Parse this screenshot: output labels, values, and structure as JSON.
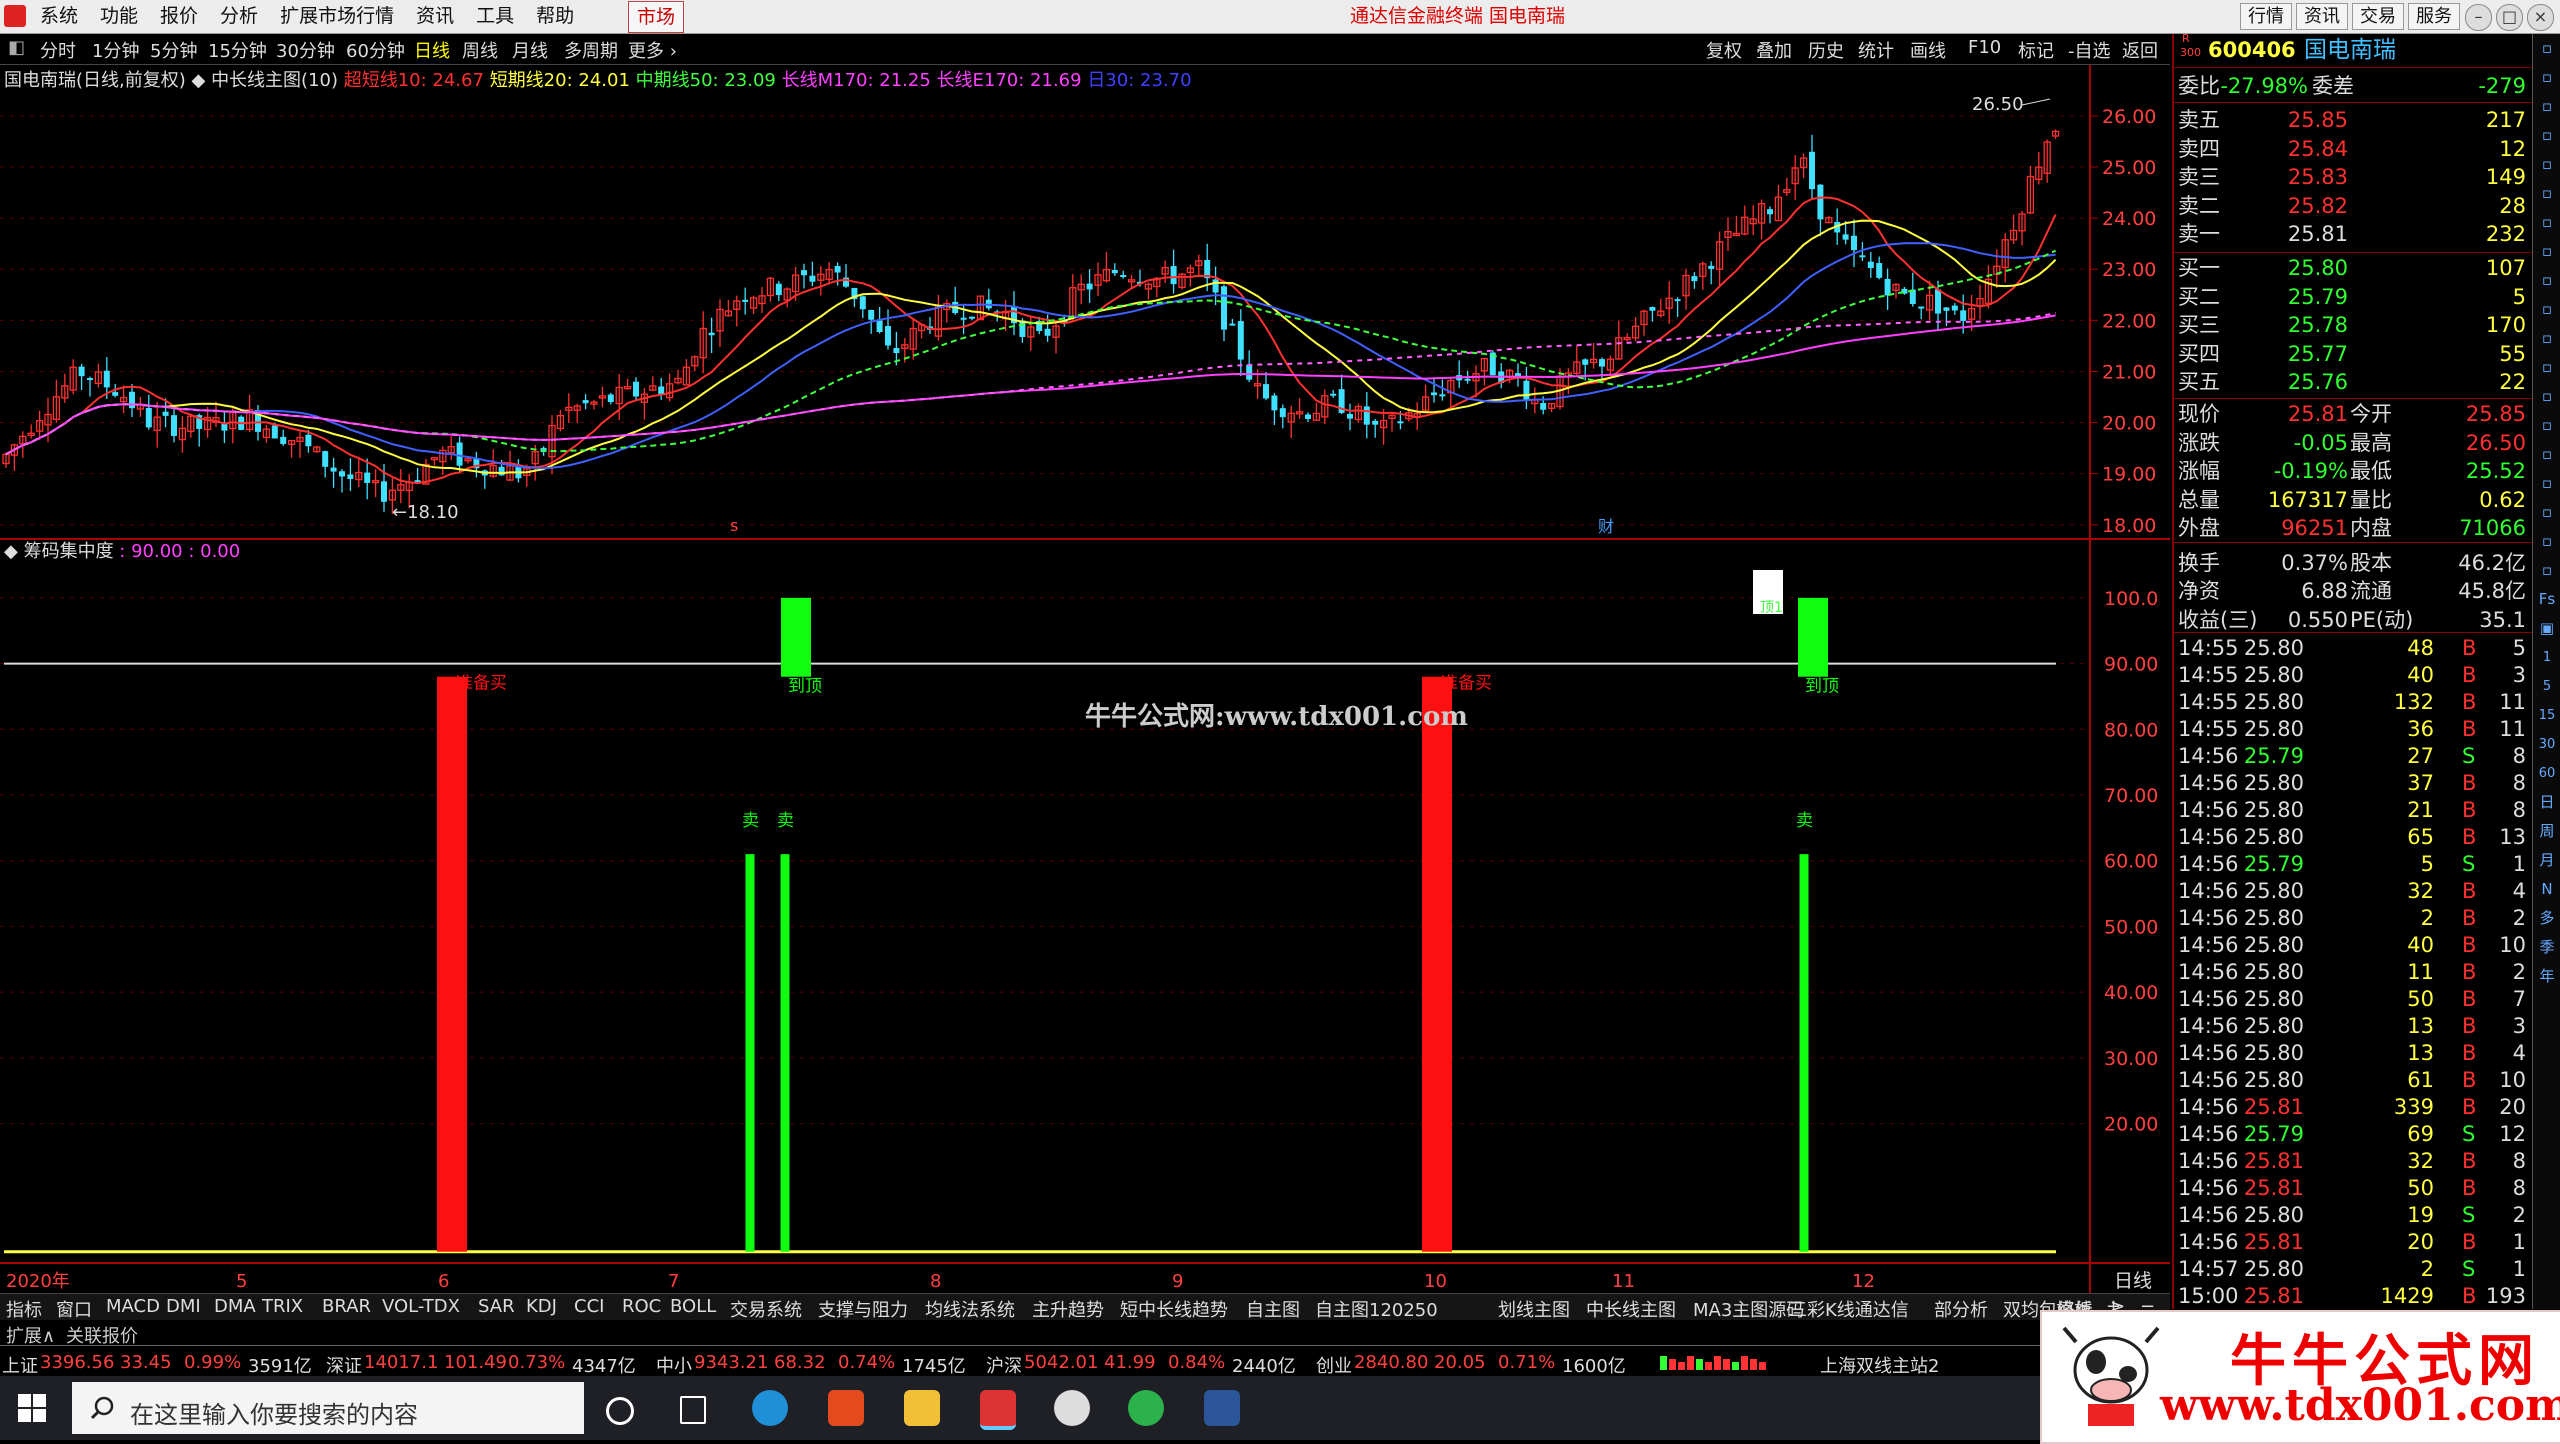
{
  "menu": [
    "系统",
    "功能",
    "报价",
    "分析",
    "扩展市场行情",
    "资讯",
    "工具",
    "帮助"
  ],
  "market_tab": "市场",
  "app_title": "通达信金融终端  国电南瑞",
  "top_buttons": [
    "行情",
    "资讯",
    "交易",
    "服务"
  ],
  "periods": [
    "分时",
    "1分钟",
    "5分钟",
    "15分钟",
    "30分钟",
    "60分钟",
    "日线",
    "周线",
    "月线",
    "多周期",
    "更多"
  ],
  "selected_period": "日线",
  "toolbar_right": [
    "复权",
    "叠加",
    "历史",
    "统计",
    "画线",
    "F10",
    "标记",
    "-自选",
    "返回"
  ],
  "chart_header": {
    "name": "国电南瑞(日线,前复权)",
    "indicator": "中长线主图(10)",
    "items": [
      {
        "text": "超短线10: 24.67",
        "color": "#ff3030"
      },
      {
        "text": "短期线20: 24.01",
        "color": "#ffff40"
      },
      {
        "text": "中期线50: 23.09",
        "color": "#40ff40"
      },
      {
        "text": "长线M170: 21.25",
        "color": "#ff40ff"
      },
      {
        "text": "长线E170: 21.69",
        "color": "#ff40ff"
      },
      {
        "text": "日30: 23.70",
        "color": "#4040ff"
      }
    ]
  },
  "sub_header": {
    "name": "筹码集中度",
    "values": ": 90.00 : 0.00"
  },
  "watermark": "牛牛公式网:www.tdx001.com",
  "chart_data": {
    "type": "candlestick",
    "price_ticks": [
      "26.00",
      "25.00",
      "24.00",
      "23.00",
      "22.00",
      "21.00",
      "20.00",
      "19.00",
      "18.00"
    ],
    "price_range": [
      17.8,
      26.8
    ],
    "high_label": "26.50",
    "low_label": "18.10",
    "osc_ticks": [
      "100.0",
      "90.00",
      "80.00",
      "70.00",
      "60.00",
      "50.00",
      "40.00",
      "30.00",
      "20.00"
    ],
    "osc_range": [
      0,
      105
    ],
    "osc_line": 90,
    "x_labels": [
      "2020年",
      "5",
      "6",
      "7",
      "8",
      "9",
      "10",
      "11",
      "12"
    ],
    "osc_signals": [
      {
        "label": "准备买",
        "value": 88,
        "color": "#ff1010",
        "kind": "buy"
      },
      {
        "label": "到顶",
        "value": 100,
        "color": "#10ff10",
        "kind": "top"
      },
      {
        "label": "卖",
        "value": 61,
        "color": "#10ff10",
        "kind": "sell"
      },
      {
        "label": "卖",
        "value": 61,
        "color": "#10ff10",
        "kind": "sell"
      },
      {
        "label": "准备买",
        "value": 88,
        "color": "#ff1010",
        "kind": "buy"
      },
      {
        "label": "到顶",
        "value": 100,
        "color": "#10ff10",
        "kind": "top"
      },
      {
        "label": "卖",
        "value": 61,
        "color": "#10ff10",
        "kind": "sell"
      }
    ],
    "bottom_right_label": "日线",
    "mark_cai": "财",
    "mark_s": "s"
  },
  "quote": {
    "code": "600406",
    "name": "国电南瑞",
    "weibi": {
      "label": "委比",
      "value": "-27.98%",
      "label2": "委差",
      "value2": "-279"
    },
    "sells": [
      {
        "label": "卖五",
        "price": "25.85",
        "vol": "217"
      },
      {
        "label": "卖四",
        "price": "25.84",
        "vol": "12"
      },
      {
        "label": "卖三",
        "price": "25.83",
        "vol": "149"
      },
      {
        "label": "卖二",
        "price": "25.82",
        "vol": "28"
      },
      {
        "label": "卖一",
        "price": "25.81",
        "vol": "232"
      }
    ],
    "buys": [
      {
        "label": "买一",
        "price": "25.80",
        "vol": "107"
      },
      {
        "label": "买二",
        "price": "25.79",
        "vol": "5"
      },
      {
        "label": "买三",
        "price": "25.78",
        "vol": "170"
      },
      {
        "label": "买四",
        "price": "25.77",
        "vol": "55"
      },
      {
        "label": "买五",
        "price": "25.76",
        "vol": "22"
      }
    ],
    "stats": [
      {
        "l1": "现价",
        "v1": "25.81",
        "c1": "#ff3030",
        "l2": "今开",
        "v2": "25.85",
        "c2": "#ff3030"
      },
      {
        "l1": "涨跌",
        "v1": "-0.05",
        "c1": "#30ff30",
        "l2": "最高",
        "v2": "26.50",
        "c2": "#ff3030"
      },
      {
        "l1": "涨幅",
        "v1": "-0.19%",
        "c1": "#30ff30",
        "l2": "最低",
        "v2": "25.52",
        "c2": "#30ff30"
      },
      {
        "l1": "总量",
        "v1": "167317",
        "c1": "#ffff40",
        "l2": "量比",
        "v2": "0.62",
        "c2": "#ffff40"
      },
      {
        "l1": "外盘",
        "v1": "96251",
        "c1": "#ff3030",
        "l2": "内盘",
        "v2": "71066",
        "c2": "#30ff30"
      },
      {
        "l1": "换手",
        "v1": "0.37%",
        "c1": "#dddddd",
        "l2": "股本",
        "v2": "46.2亿",
        "c2": "#dddddd"
      },
      {
        "l1": "净资",
        "v1": "6.88",
        "c1": "#dddddd",
        "l2": "流通",
        "v2": "45.8亿",
        "c2": "#dddddd"
      },
      {
        "l1": "收益(三)",
        "v1": "0.550",
        "c1": "#dddddd",
        "l2": "PE(动)",
        "v2": "35.1",
        "c2": "#dddddd"
      }
    ],
    "ticks": [
      [
        "14:55",
        "25.80",
        "48",
        "B",
        "5"
      ],
      [
        "14:55",
        "25.80",
        "40",
        "B",
        "3"
      ],
      [
        "14:55",
        "25.80",
        "132",
        "B",
        "11"
      ],
      [
        "14:55",
        "25.80",
        "36",
        "B",
        "11"
      ],
      [
        "14:56",
        "25.79",
        "27",
        "S",
        "8"
      ],
      [
        "14:56",
        "25.80",
        "37",
        "B",
        "8"
      ],
      [
        "14:56",
        "25.80",
        "21",
        "B",
        "8"
      ],
      [
        "14:56",
        "25.80",
        "65",
        "B",
        "13"
      ],
      [
        "14:56",
        "25.79",
        "5",
        "S",
        "1"
      ],
      [
        "14:56",
        "25.80",
        "32",
        "B",
        "4"
      ],
      [
        "14:56",
        "25.80",
        "2",
        "B",
        "2"
      ],
      [
        "14:56",
        "25.80",
        "40",
        "B",
        "10"
      ],
      [
        "14:56",
        "25.80",
        "11",
        "B",
        "2"
      ],
      [
        "14:56",
        "25.80",
        "50",
        "B",
        "7"
      ],
      [
        "14:56",
        "25.80",
        "13",
        "B",
        "3"
      ],
      [
        "14:56",
        "25.80",
        "13",
        "B",
        "4"
      ],
      [
        "14:56",
        "25.80",
        "61",
        "B",
        "10"
      ],
      [
        "14:56",
        "25.81",
        "339",
        "B",
        "20"
      ],
      [
        "14:56",
        "25.79",
        "69",
        "S",
        "12"
      ],
      [
        "14:56",
        "25.81",
        "32",
        "B",
        "8"
      ],
      [
        "14:56",
        "25.81",
        "50",
        "B",
        "8"
      ],
      [
        "14:56",
        "25.80",
        "19",
        "S",
        "2"
      ],
      [
        "14:56",
        "25.81",
        "20",
        "B",
        "1"
      ],
      [
        "14:57",
        "25.80",
        "2",
        "S",
        "1"
      ],
      [
        "15:00",
        "25.81",
        "1429",
        "B",
        "193"
      ]
    ]
  },
  "sidebar": [
    "日",
    "周",
    "月",
    "N",
    "多",
    "季",
    "年"
  ],
  "indicator_tabs": [
    "指标",
    "窗口",
    "MACD",
    "DMI",
    "DMA",
    "TRIX",
    "BRAR",
    "VOL-TDX",
    "SAR",
    "KDJ",
    "CCI",
    "ROC",
    "BOLL",
    "交易系统",
    "支撑与阻力",
    "均线法系统",
    "主升趋势",
    "短中长线趋势",
    "自主图",
    "自主图120250",
    "划线主图",
    "中长线主图",
    "MA3主图源码",
    "三彩K线通达信",
    "部分析",
    "双均包络线",
    ">"
  ],
  "tabs_right": "模板",
  "sub_tabs": [
    "扩展∧",
    "关联报价"
  ],
  "status": [
    {
      "label": "上证",
      "vals": [
        {
          "t": "3396.56",
          "c": "#ff4040"
        },
        {
          "t": "33.45",
          "c": "#ff4040"
        },
        {
          "t": "0.99%",
          "c": "#ff4040"
        },
        {
          "t": "3591亿",
          "c": "#dddddd"
        }
      ]
    },
    {
      "label": "深证",
      "vals": [
        {
          "t": "14017.1",
          "c": "#ff4040"
        },
        {
          "t": "101.49",
          "c": "#ff4040"
        },
        {
          "t": "0.73%",
          "c": "#ff4040"
        },
        {
          "t": "4347亿",
          "c": "#dddddd"
        }
      ]
    },
    {
      "label": "中小",
      "vals": [
        {
          "t": "9343.21",
          "c": "#ff4040"
        },
        {
          "t": "68.32",
          "c": "#ff4040"
        },
        {
          "t": "0.74%",
          "c": "#ff4040"
        },
        {
          "t": "1745亿",
          "c": "#dddddd"
        }
      ]
    },
    {
      "label": "沪深",
      "vals": [
        {
          "t": "5042.01",
          "c": "#ff4040"
        },
        {
          "t": "41.99",
          "c": "#ff4040"
        },
        {
          "t": "0.84%",
          "c": "#ff4040"
        },
        {
          "t": "2440亿",
          "c": "#dddddd"
        }
      ]
    },
    {
      "label": "创业",
      "vals": [
        {
          "t": "2840.80",
          "c": "#ff4040"
        },
        {
          "t": "20.05",
          "c": "#ff4040"
        },
        {
          "t": "0.71%",
          "c": "#ff4040"
        },
        {
          "t": "1600亿",
          "c": "#dddddd"
        }
      ]
    }
  ],
  "status_right": "上海双线主站2",
  "search_placeholder": "在这里输入你要搜索的内容",
  "logo_text": "牛牛公式网",
  "logo_url": "www.tdx001.com"
}
